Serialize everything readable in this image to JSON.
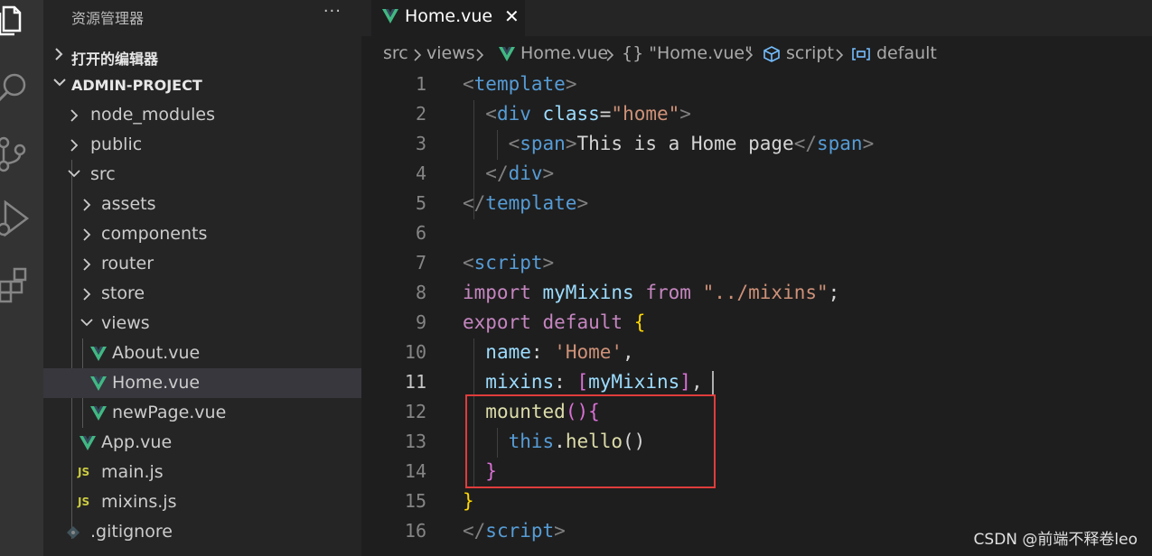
{
  "colors": {
    "activity_bar": "#333333",
    "sidebar_bg": "#252526",
    "editor_bg": "#1e1e1e",
    "vue_green": "#41b883",
    "js_yellow": "#cbcb41",
    "highlight_border": "#e03c3c"
  },
  "activity_icons": [
    "files-icon",
    "search-icon",
    "source-control-icon",
    "run-debug-icon",
    "extensions-icon"
  ],
  "sidebar": {
    "title": "资源管理器",
    "more": "···",
    "open_editors": "打开的编辑器",
    "project": "ADMIN-PROJECT",
    "tree": [
      {
        "label": "node_modules",
        "icon": "chevron-right-icon"
      },
      {
        "label": "public",
        "icon": "chevron-right-icon"
      },
      {
        "label": "src",
        "icon": "chevron-down-icon"
      },
      {
        "label": "assets",
        "icon": "chevron-right-icon"
      },
      {
        "label": "components",
        "icon": "chevron-right-icon"
      },
      {
        "label": "router",
        "icon": "chevron-right-icon"
      },
      {
        "label": "store",
        "icon": "chevron-right-icon"
      },
      {
        "label": "views",
        "icon": "chevron-down-icon"
      },
      {
        "label": "About.vue",
        "icon": "vue-file-icon"
      },
      {
        "label": "Home.vue",
        "icon": "vue-file-icon",
        "selected": true
      },
      {
        "label": "newPage.vue",
        "icon": "vue-file-icon"
      },
      {
        "label": "App.vue",
        "icon": "vue-file-icon"
      },
      {
        "label": "main.js",
        "icon": "js-file-icon",
        "badge": "JS"
      },
      {
        "label": "mixins.js",
        "icon": "js-file-icon",
        "badge": "JS"
      },
      {
        "label": ".gitignore",
        "icon": "git-file-icon"
      }
    ]
  },
  "tab": {
    "label": "Home.vue",
    "close": "✕"
  },
  "breadcrumb": {
    "parts": [
      "src",
      "views",
      "Home.vue",
      "{} \"Home.vue\"",
      "script",
      "default"
    ]
  },
  "editor": {
    "current_line": 11,
    "lines": [
      {
        "n": "1"
      },
      {
        "n": "2"
      },
      {
        "n": "3"
      },
      {
        "n": "4"
      },
      {
        "n": "5"
      },
      {
        "n": "6"
      },
      {
        "n": "7"
      },
      {
        "n": "8"
      },
      {
        "n": "9"
      },
      {
        "n": "10"
      },
      {
        "n": "11"
      },
      {
        "n": "12"
      },
      {
        "n": "13"
      },
      {
        "n": "14"
      },
      {
        "n": "15"
      },
      {
        "n": "16"
      }
    ],
    "tokens": {
      "l1": [
        "<",
        "template",
        ">"
      ],
      "l2": [
        "<",
        "div",
        "class",
        "=",
        "\"home\"",
        ">"
      ],
      "l3": [
        "<",
        "span",
        ">",
        "This is a Home page",
        "</",
        "span",
        ">"
      ],
      "l4": [
        "</",
        "div",
        ">"
      ],
      "l5": [
        "</",
        "template",
        ">"
      ],
      "l7": [
        "<",
        "script",
        ">"
      ],
      "l8": [
        "import",
        "myMixins",
        "from",
        "\"../mixins\"",
        ";"
      ],
      "l9": [
        "export",
        "default",
        "{"
      ],
      "l10": [
        "name",
        ":",
        "'Home'",
        ","
      ],
      "l11": [
        "mixins",
        ":",
        "[",
        "myMixins",
        "]",
        ","
      ],
      "l12": [
        "mounted",
        "()",
        "{"
      ],
      "l13": [
        "this",
        ".",
        "hello",
        "()"
      ],
      "l14": [
        "}"
      ],
      "l15": [
        "}"
      ],
      "l16": [
        "</",
        "script",
        ">"
      ]
    }
  },
  "watermark": "CSDN @前端不释卷leo"
}
